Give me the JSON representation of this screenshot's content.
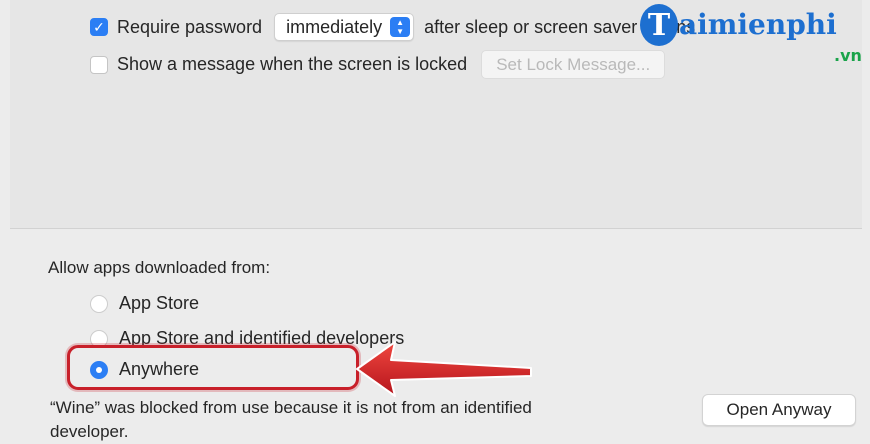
{
  "security": {
    "require_password": {
      "checked": true,
      "label_before": "Require password",
      "popup_value": "immediately",
      "label_after": "after sleep or screen saver begins"
    },
    "show_message": {
      "checked": false,
      "label": "Show a message when the screen is locked",
      "button_label": "Set Lock Message..."
    }
  },
  "gatekeeper": {
    "heading": "Allow apps downloaded from:",
    "options": [
      {
        "label": "App Store",
        "selected": false
      },
      {
        "label": "App Store and identified developers",
        "selected": false
      },
      {
        "label": "Anywhere",
        "selected": true
      }
    ],
    "blocked_message": "“Wine” was blocked from use because it is not from an identified developer.",
    "open_anyway_label": "Open Anyway"
  },
  "watermark": {
    "badge": "T",
    "text": "aimienphi",
    "suffix": ".vn"
  },
  "colors": {
    "accent": "#2b7ef4",
    "annotation": "#c8202a",
    "watermark_blue": "#1d6fd0",
    "watermark_green": "#1aa34a"
  }
}
